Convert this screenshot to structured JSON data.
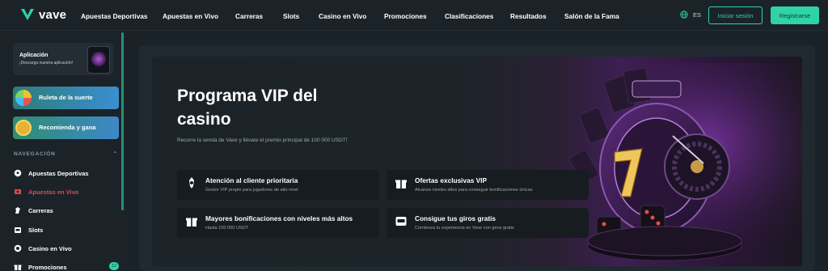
{
  "header": {
    "brand": "vave",
    "nav": [
      "Apuestas Deportivas",
      "Apuestas en Vivo",
      "Carreras",
      "Slots",
      "Casino en Vivo",
      "Promociones",
      "Clasificaciones",
      "Resultados",
      "Salón de la Fama"
    ],
    "language": "ES",
    "login_label": "Iniciar sesión",
    "register_label": "Registrarse"
  },
  "sidebar": {
    "app_title": "Aplicación",
    "app_subtitle": "¡Descarga nuestra aplicación!",
    "promo_wheel": "Ruleta de la suerte",
    "promo_refer": "Recomienda y gana",
    "nav_heading": "NAVEGACIÓN",
    "items": [
      {
        "label": "Apuestas Deportivas",
        "icon": "soccer-ball-icon"
      },
      {
        "label": "Apuestas en Vivo",
        "icon": "live-icon"
      },
      {
        "label": "Carreras",
        "icon": "horse-icon"
      },
      {
        "label": "Slots",
        "icon": "slots-icon"
      },
      {
        "label": "Casino en Vivo",
        "icon": "chip-icon"
      },
      {
        "label": "Promociones",
        "icon": "gift-icon"
      }
    ],
    "promos_badge": "12"
  },
  "hero": {
    "title": "Programa VIP del casino",
    "description": "Recorre la senda de Vave y llévate el premio principal de 100 000 USDT!",
    "features": [
      {
        "title": "Atención al cliente prioritaria",
        "subtitle": "Gestor VIP propio para jugadores de alto nivel",
        "icon": "support-icon"
      },
      {
        "title": "Ofertas exclusivas VIP",
        "subtitle": "Alcanza niveles altos para conseguir bonificaciones únicas",
        "icon": "gift-icon"
      },
      {
        "title": "Mayores bonificaciones con niveles más altos",
        "subtitle": "Hasta 100 000 USDT",
        "icon": "gift-icon"
      },
      {
        "title": "Consigue tus giros gratis",
        "subtitle": "Comienza tu experiencia en Vave con giros gratis",
        "icon": "slot-machine-icon"
      }
    ]
  },
  "colors": {
    "accent": "#2fd3a5",
    "background": "#1a2228",
    "active_nav": "#e5484d",
    "hero_purple": "#3d1f52"
  }
}
